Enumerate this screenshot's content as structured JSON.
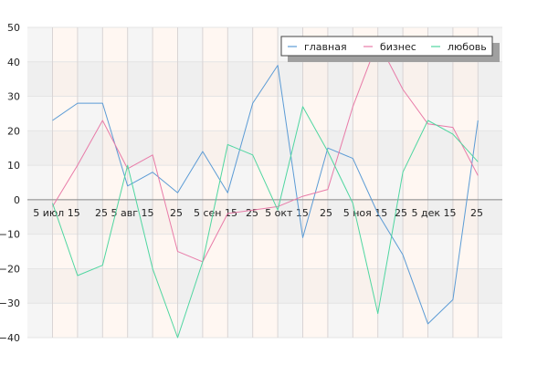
{
  "chart_data": {
    "type": "line",
    "x_labels": [
      "5 июл 15",
      "25",
      "5 авг 15",
      "25",
      "5 сен 15",
      "25",
      "5 окт 15",
      "25",
      "5 ноя 15",
      "25",
      "5 дек 15",
      "25"
    ],
    "ylim": [
      -40,
      50
    ],
    "yticks": [
      -40,
      -30,
      -20,
      -10,
      0,
      10,
      20,
      30,
      40,
      50
    ],
    "grid": true,
    "legend_position": "top-right",
    "series": [
      {
        "name": "главная",
        "color": "#5b9bd5",
        "values": [
          23,
          28,
          28,
          4,
          8,
          2,
          14,
          2,
          28,
          39,
          -11,
          15,
          12,
          -4,
          -16,
          -36,
          -29,
          23
        ]
      },
      {
        "name": "бизнес",
        "color": "#e87ba8",
        "values": [
          -2,
          10,
          23,
          9,
          13,
          -15,
          -18,
          -4,
          -3,
          -2,
          1,
          3,
          27,
          46,
          32,
          22,
          21,
          7
        ]
      },
      {
        "name": "любовь",
        "color": "#4fd6a0",
        "values": [
          -1,
          -22,
          -19,
          10,
          -20,
          -40,
          -18,
          16,
          13,
          -3,
          27,
          14,
          -1,
          -33,
          8,
          23,
          19,
          11
        ]
      }
    ]
  }
}
